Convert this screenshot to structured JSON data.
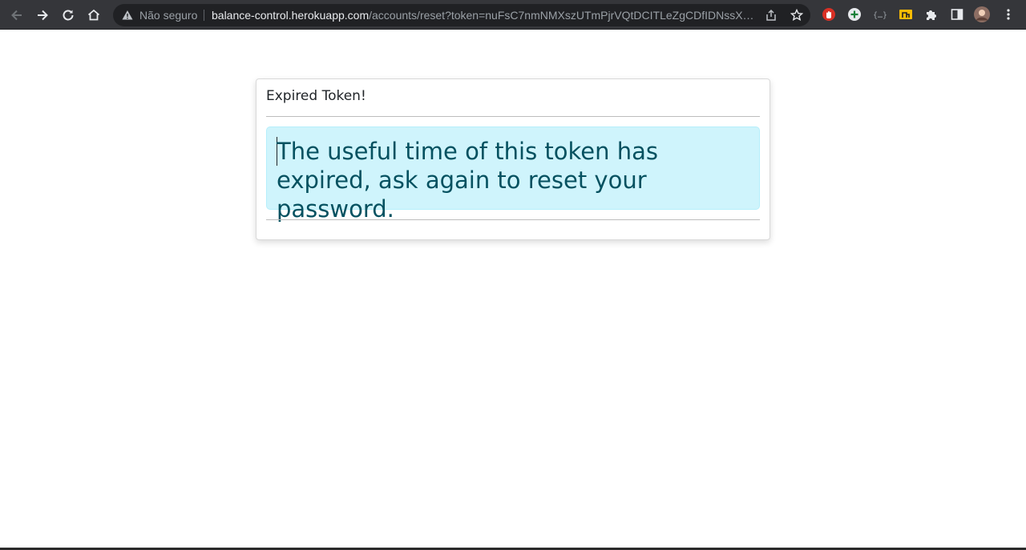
{
  "browser": {
    "security_label": "Não seguro",
    "url_host": "balance-control.herokuapp.com",
    "url_path": "/accounts/reset?token=nuFsC7nmNMXszUTmPjrVQtDCITLeZgCDfIDNssXWd...",
    "icons": {
      "back": "arrow-left-icon",
      "forward": "arrow-right-icon",
      "reload": "reload-icon",
      "home": "home-icon",
      "warning": "warning-triangle-icon",
      "share": "share-icon",
      "bookmark": "star-icon",
      "extensions": "puzzle-icon",
      "side_panel": "side-panel-icon",
      "menu": "kebab-menu-icon"
    }
  },
  "card": {
    "title": "Expired Token!",
    "message": "The useful time of this token has expired, ask again to reset your password."
  },
  "colors": {
    "alert_bg": "#cff4fc",
    "alert_text": "#055160",
    "toolbar_bg": "#35363a"
  }
}
